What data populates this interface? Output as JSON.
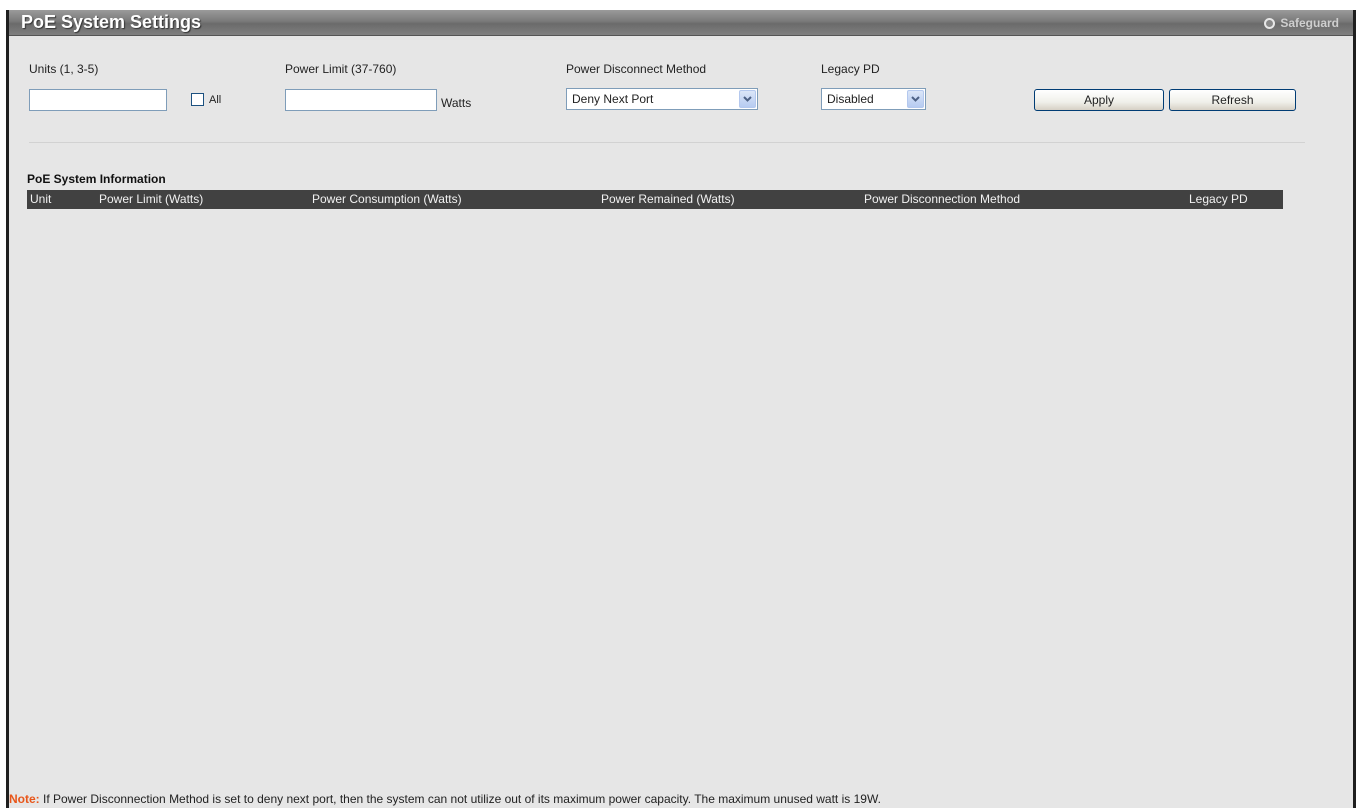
{
  "title": "PoE System Settings",
  "safeguard": "Safeguard",
  "form": {
    "units": {
      "label": "Units (1, 3-5)",
      "value": "",
      "all_label": "All",
      "all_checked": false
    },
    "power_limit": {
      "label": "Power Limit  (37-760)",
      "value": "",
      "unit": "Watts"
    },
    "disconnect_method": {
      "label": "Power Disconnect Method",
      "selected": "Deny Next Port"
    },
    "legacy_pd": {
      "label": "Legacy PD",
      "selected": "Disabled"
    },
    "apply_label": "Apply",
    "refresh_label": "Refresh"
  },
  "info": {
    "title": "PoE System Information",
    "columns": [
      "Unit",
      "Power Limit (Watts)",
      "Power Consumption (Watts)",
      "Power Remained (Watts)",
      "Power Disconnection Method",
      "Legacy PD"
    ],
    "rows": []
  },
  "note": {
    "prefix": "Note:",
    "text": " If Power Disconnection Method is set to deny next port, then the system can not utilize out of its maximum power capacity. The maximum unused watt is 19W."
  },
  "colors": {
    "title_bar": "#7a7a7a",
    "table_header": "#414141",
    "note_accent": "#e8561a",
    "background": "#e6e6e6"
  }
}
